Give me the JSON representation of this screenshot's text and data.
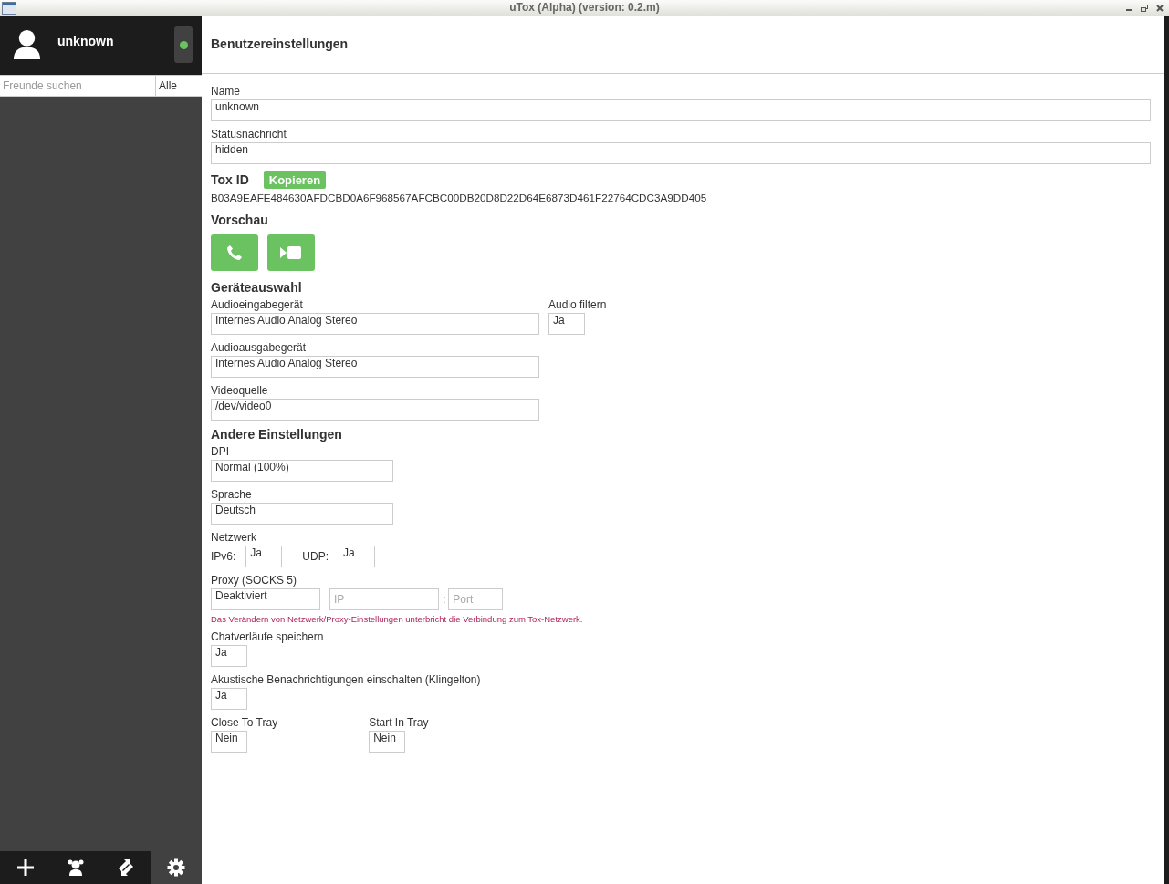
{
  "window": {
    "title": "uTox (Alpha) (version: 0.2.m)"
  },
  "sidebar": {
    "user": {
      "name": "unknown",
      "online": true
    },
    "search": {
      "placeholder": "Freunde suchen"
    },
    "filter": "Alle",
    "toolbar": [
      {
        "kind": "add",
        "selected": false
      },
      {
        "kind": "groups",
        "selected": false
      },
      {
        "kind": "transfers",
        "selected": false
      },
      {
        "kind": "settings",
        "selected": true
      }
    ]
  },
  "settings": {
    "title": "Benutzereinstellungen",
    "name": {
      "label": "Name",
      "value": "unknown"
    },
    "status_message": {
      "label": "Statusnachricht",
      "value": "hidden"
    },
    "tox_id": {
      "label": "Tox ID",
      "copy_button": "Kopieren",
      "value": "B03A9EAFE484630AFDCBD0A6F968567AFCBC00DB20D8D22D64E6873D461F22764CDC3A9DD405"
    },
    "preview": {
      "heading": "Vorschau"
    },
    "devices": {
      "heading": "Geräteauswahl",
      "audio_input": {
        "label": "Audioeingabegerät",
        "value": "Internes Audio Analog Stereo"
      },
      "audio_filter": {
        "label": "Audio filtern",
        "value": "Ja"
      },
      "audio_output": {
        "label": "Audioausgabegerät",
        "value": "Internes Audio Analog Stereo"
      },
      "video_source": {
        "label": "Videoquelle",
        "value": "/dev/video0"
      }
    },
    "other": {
      "heading": "Andere Einstellungen",
      "dpi": {
        "label": "DPI",
        "value": "Normal (100%)"
      },
      "language": {
        "label": "Sprache",
        "value": "Deutsch"
      },
      "network": {
        "label": "Netzwerk",
        "ipv6": {
          "label": "IPv6:",
          "value": "Ja"
        },
        "udp": {
          "label": "UDP:",
          "value": "Ja"
        }
      },
      "proxy": {
        "label": "Proxy (SOCKS 5)",
        "mode": "Deaktiviert",
        "ip": {
          "placeholder": "IP"
        },
        "separator": ":",
        "port": {
          "placeholder": "Port"
        },
        "note": "Das Verändern von Netzwerk/Proxy-Einstellungen unterbricht die Verbindung zum Tox-Netzwerk."
      },
      "chat_history": {
        "label": "Chatverläufe speichern",
        "value": "Ja"
      },
      "notifications": {
        "label": "Akustische Benachrichtigungen einschalten (Klingelton)",
        "value": "Ja"
      },
      "close_to_tray": {
        "label": "Close To Tray",
        "value": "Nein"
      },
      "start_in_tray": {
        "label": "Start In Tray",
        "value": "Nein"
      }
    }
  }
}
